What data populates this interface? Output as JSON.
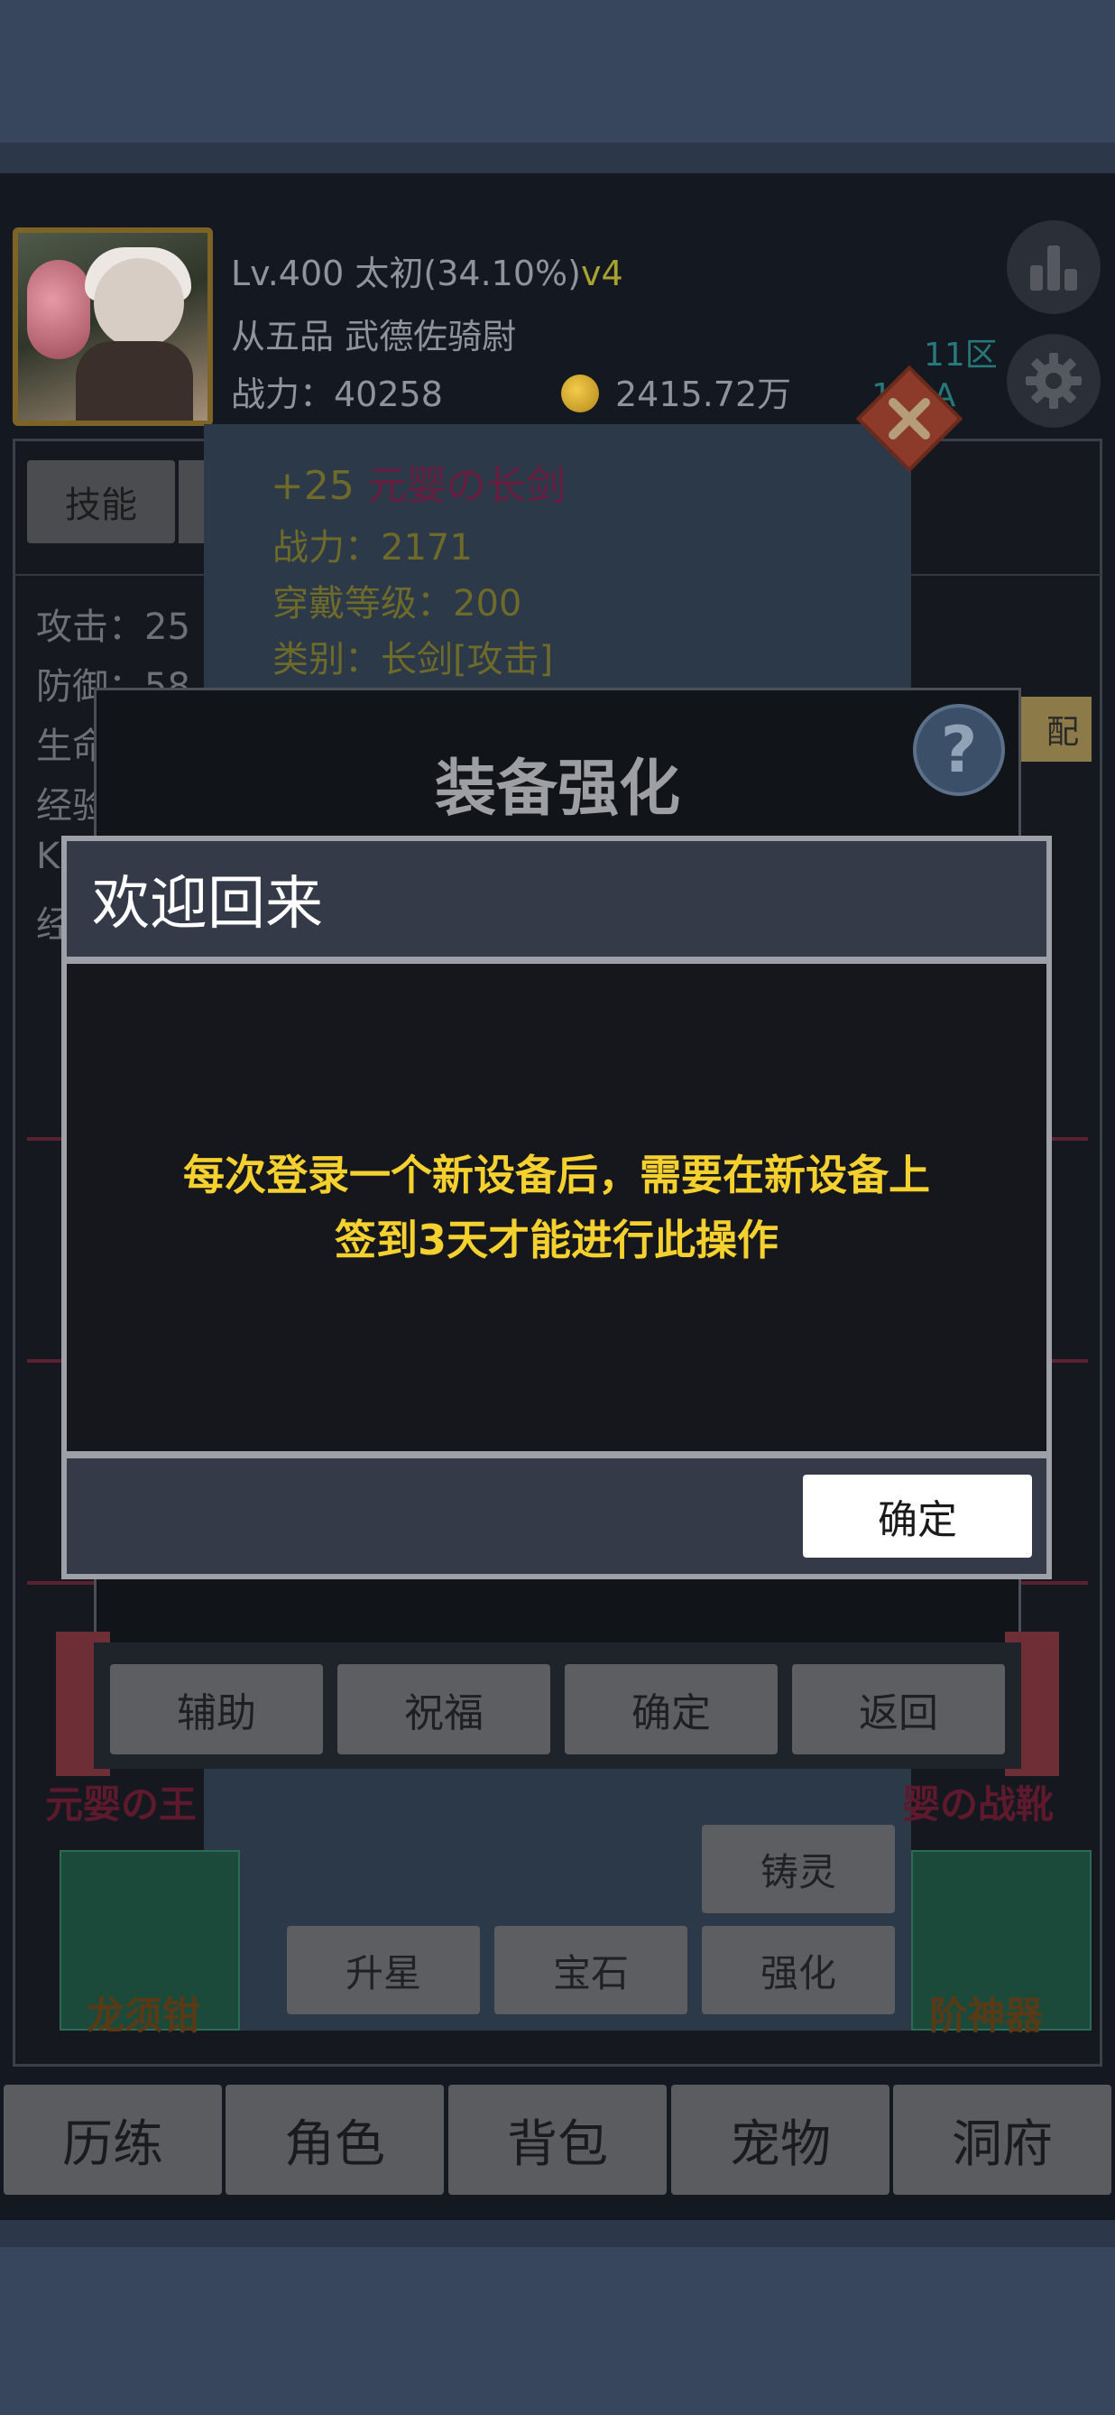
{
  "header": {
    "level": "Lv.400 太初(34.10%)",
    "level_tag": "v4",
    "rank_title": "从五品 武德佐骑尉",
    "power": "战力：40258",
    "coins": "2415.72万",
    "zone": "11区",
    "server_id": "1··9A",
    "stats_icon": "bar-chart-icon",
    "settings_icon": "gear-icon"
  },
  "char_panel": {
    "tab_skill": "技能",
    "stats": [
      "攻击：25",
      "防御：58",
      "生命",
      "经验",
      "K",
      "经"
    ],
    "match_label": "配"
  },
  "tooltip": {
    "enhance_level": "+25",
    "item_name": "元婴の长剑",
    "power": "战力：2171",
    "equip_level": "穿戴等级：200",
    "category": "类别：长剑[攻击]"
  },
  "enhance": {
    "title": "装备强化",
    "help_label": "?",
    "buttons": [
      "辅助",
      "祝福",
      "确定",
      "返回"
    ],
    "left_item_name": "元婴の王",
    "right_item_name": "婴の战靴"
  },
  "item_actions": {
    "cast": "铸灵",
    "star": "升星",
    "gem": "宝石",
    "enhance": "强化"
  },
  "cards": {
    "left_label": "龙须钳",
    "right_label": "阶神器"
  },
  "nav": [
    "历练",
    "角色",
    "背包",
    "宠物",
    "洞府"
  ],
  "welcome": {
    "title": "欢迎回来",
    "message_line1": "每次登录一个新设备后，需要在新设备上",
    "message_line2": "签到3天才能进行此操作",
    "ok_label": "确定"
  }
}
